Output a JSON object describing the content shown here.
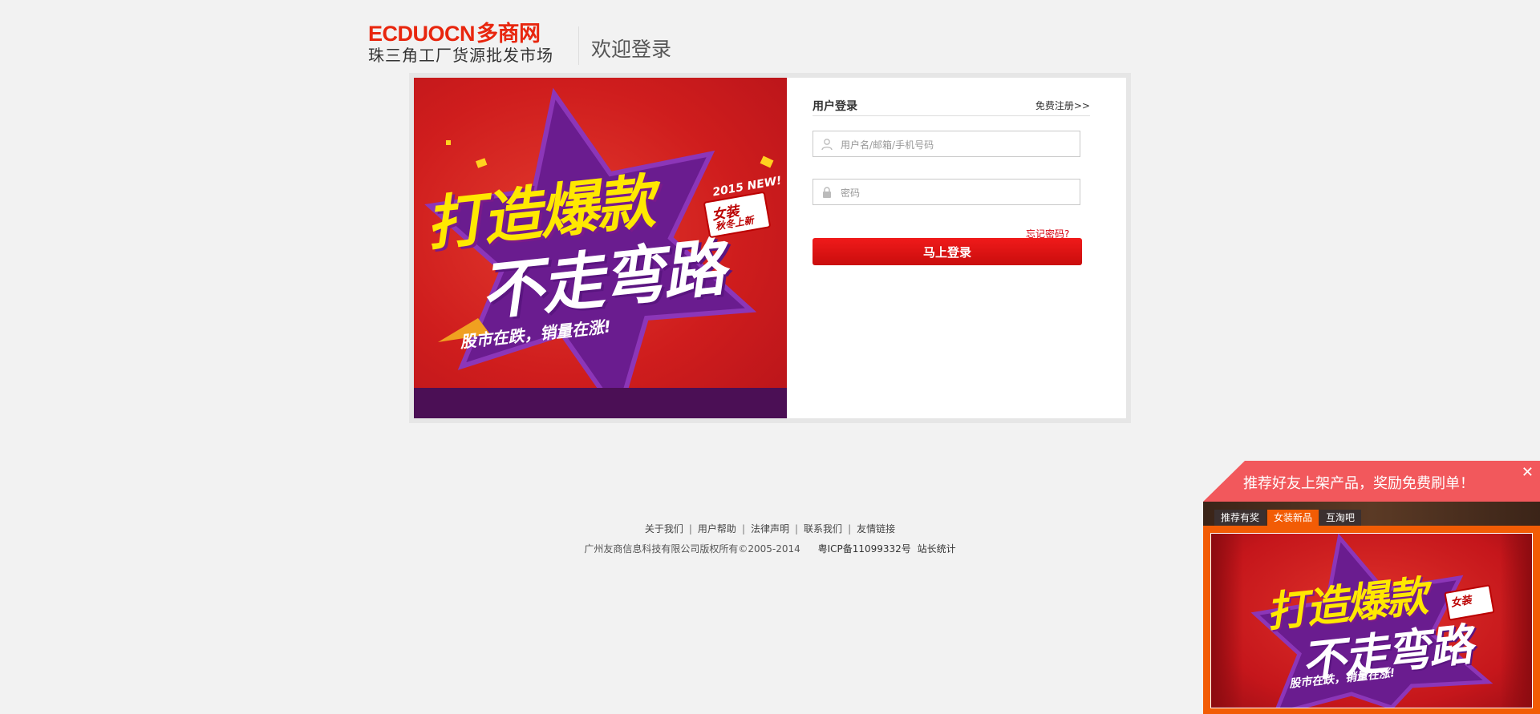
{
  "header": {
    "logo_en": "ECDUOCN",
    "logo_cn": "多商网",
    "logo_sub": "珠三角工厂货源批发市场",
    "welcome": "欢迎登录"
  },
  "banner": {
    "line1": "打造爆款",
    "line2": "不走弯路",
    "line3": "股市在跌，销量在涨!",
    "badge_top": "2015 NEW!",
    "badge_main": "女装",
    "badge_sub": "秋冬上新"
  },
  "login": {
    "title": "用户登录",
    "register": "免费注册>>",
    "username_placeholder": "用户名/邮箱/手机号码",
    "password_placeholder": "密码",
    "forgot": "忘记密码?",
    "submit": "马上登录"
  },
  "footer": {
    "links": [
      "关于我们",
      "用户帮助",
      "法律声明",
      "联系我们",
      "友情链接"
    ],
    "separator": "|",
    "copyright": "广州友商信息科技有限公司版权所有©2005-2014",
    "icp": "粤ICP备11099332号",
    "stats": "站长统计"
  },
  "popup": {
    "title": "推荐好友上架产品，奖励免费刷单！",
    "close": "✕",
    "tabs": [
      "推荐有奖",
      "女装新品",
      "互淘吧"
    ],
    "active_tab": "女装新品"
  },
  "colors": {
    "brand_red": "#e8260e",
    "button_red": "#e01212",
    "link_red": "#d6000f",
    "popup_orange": "#f25c05",
    "popup_head": "#f2585c"
  },
  "icons": {
    "user_icon": "user-silhouette",
    "password_icon": "lock",
    "close_icon": "x-mark"
  }
}
